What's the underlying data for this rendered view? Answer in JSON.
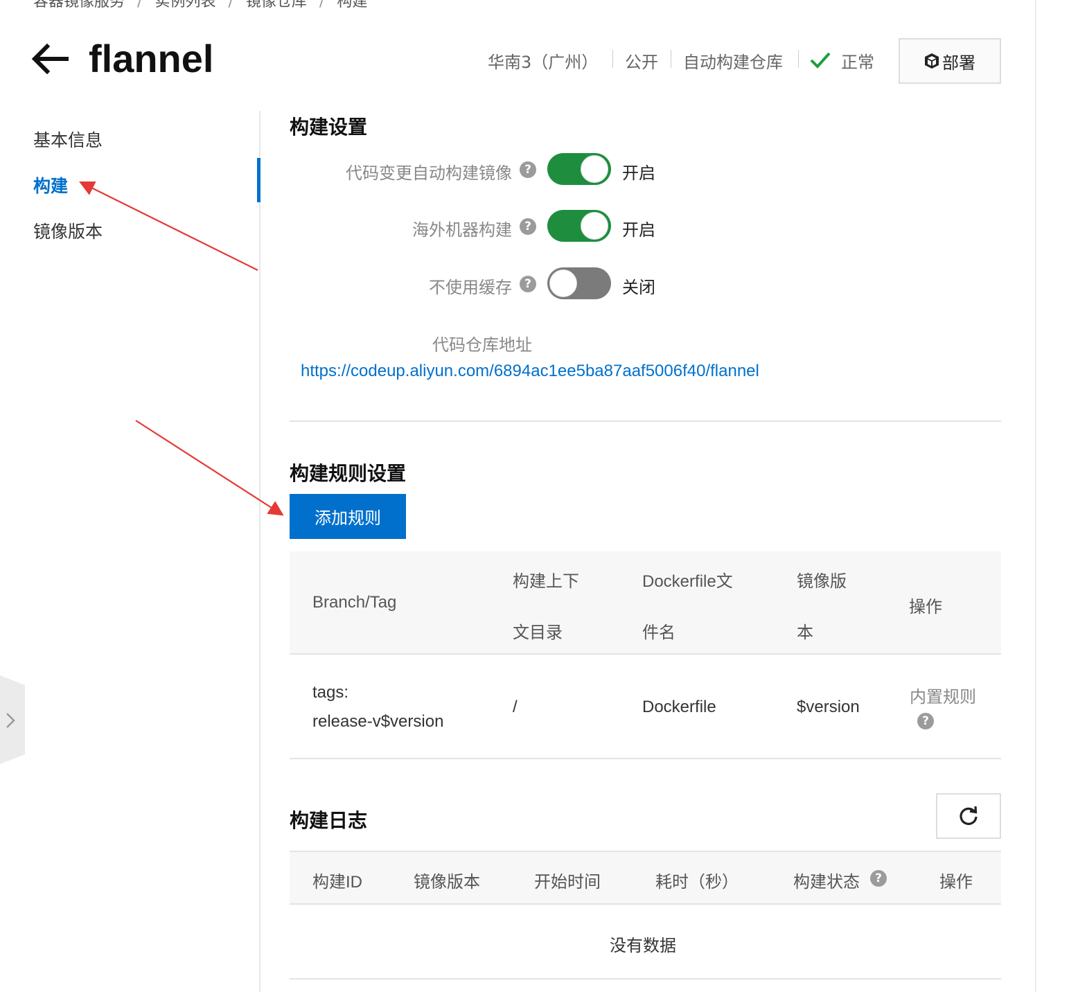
{
  "breadcrumb": [
    "容器镜像服务",
    "实例列表",
    "镜像仓库",
    "构建"
  ],
  "header": {
    "title": "flannel",
    "region": "华南3（广州）",
    "visibility": "公开",
    "repo_type": "自动构建仓库",
    "status": "正常",
    "deploy_label": "部署"
  },
  "sidebar": {
    "items": [
      {
        "label": "基本信息"
      },
      {
        "label": "构建"
      },
      {
        "label": "镜像版本"
      }
    ],
    "active": "构建"
  },
  "build_settings": {
    "title": "构建设置",
    "auto_build": {
      "label": "代码变更自动构建镜像",
      "state": "开启",
      "on": true
    },
    "overseas_build": {
      "label": "海外机器构建",
      "state": "开启",
      "on": true
    },
    "no_cache": {
      "label": "不使用缓存",
      "state": "关闭",
      "on": false
    },
    "repo_label": "代码仓库地址",
    "repo_url": "https://codeup.aliyun.com/6894ac1ee5ba87aaf5006f40/flannel"
  },
  "build_rules": {
    "title": "构建规则设置",
    "add_label": "添加规则",
    "columns": {
      "branch": "Branch/Tag",
      "context_l1": "构建上下",
      "context_l2": "文目录",
      "dockerfile_l1": "Dockerfile文",
      "dockerfile_l2": "件名",
      "version_l1": "镜像版",
      "version_l2": "本",
      "ops": "操作"
    },
    "rows": [
      {
        "branch_l1": "tags:",
        "branch_l2": "release-v$version",
        "context": "/",
        "dockerfile": "Dockerfile",
        "version": "$version",
        "ops": "内置规则"
      }
    ]
  },
  "build_logs": {
    "title": "构建日志",
    "columns": [
      "构建ID",
      "镜像版本",
      "开始时间",
      "耗时（秒）",
      "构建状态",
      "操作"
    ],
    "empty": "没有数据"
  },
  "colors": {
    "accent": "#0070cc",
    "toggle_on": "#1e8e3e",
    "toggle_off": "#7b7b7b",
    "annotation_arrow": "#e53935"
  }
}
